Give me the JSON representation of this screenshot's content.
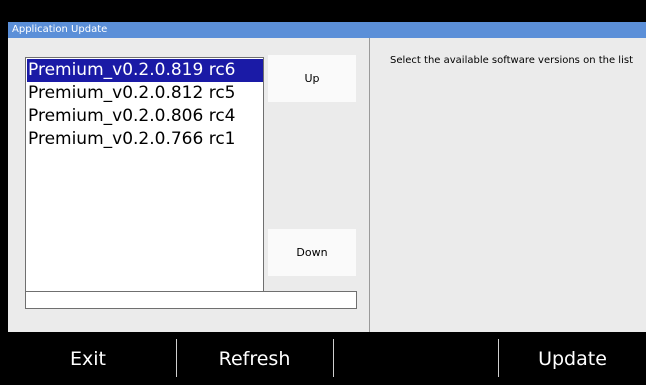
{
  "window": {
    "title": "Application Update"
  },
  "versions": [
    "Premium_v0.2.0.819 rc6",
    "Premium_v0.2.0.812 rc5",
    "Premium_v0.2.0.806 rc4",
    "Premium_v0.2.0.766 rc1"
  ],
  "selected_index": 0,
  "buttons": {
    "up": "Up",
    "down": "Down"
  },
  "progress": {
    "value": 0
  },
  "info_text": "Select the available software versions on the list",
  "nav": {
    "exit": "Exit",
    "refresh": "Refresh",
    "empty": "",
    "update": "Update"
  },
  "colors": {
    "accent": "#5b8fd8",
    "selection": "#1a1aa6",
    "panel": "#ebebeb"
  }
}
